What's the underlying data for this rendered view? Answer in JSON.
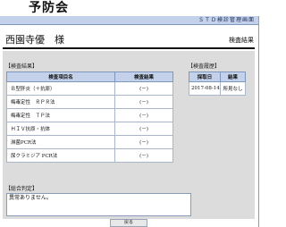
{
  "header": {
    "org_title": "予防会",
    "system_name": "ＳＴＤ検診管理画面"
  },
  "patient": {
    "name": "西園寺優　様",
    "page_title": "検査結果"
  },
  "results": {
    "section_label": "【検査結果】",
    "columns": [
      "検査項目名",
      "検査結果"
    ],
    "rows": [
      {
        "item": "Ｂ型肝炎（＋抗原）",
        "result": "(－)"
      },
      {
        "item": "梅毒定性　ＲＰＲ法",
        "result": "(－)"
      },
      {
        "item": "梅毒定性　ＴＰ法",
        "result": "(－)"
      },
      {
        "item": "ＨＩＶ抗原・抗体",
        "result": "(－)"
      },
      {
        "item": "淋菌PCR法",
        "result": "(－)"
      },
      {
        "item": "尿クラミジア PCR法",
        "result": "(－)"
      }
    ]
  },
  "history": {
    "section_label": "【検査履歴】",
    "columns": [
      "採取日",
      "結果"
    ],
    "rows": [
      {
        "date": "2017-08-14",
        "result": "所見なし"
      }
    ]
  },
  "judgement": {
    "section_label": "【総合判定】",
    "text": "異常ありません。"
  },
  "footer": {
    "back_label": "戻る"
  }
}
